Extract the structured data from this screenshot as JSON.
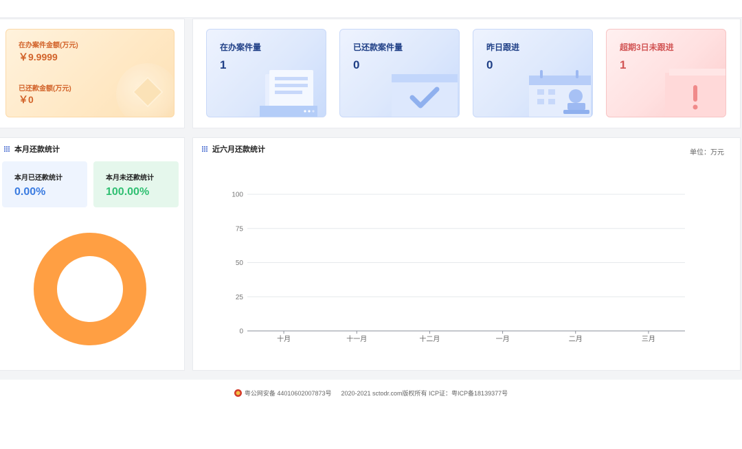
{
  "money": {
    "active_label": "在办案件金额(万元)",
    "active_value": "￥9.9999",
    "repaid_label": "已还款金额(万元)",
    "repaid_value": "￥0"
  },
  "stats": [
    {
      "title": "在办案件量",
      "value": "1"
    },
    {
      "title": "已还款案件量",
      "value": "0"
    },
    {
      "title": "昨日跟进",
      "value": "0"
    },
    {
      "title": "超期3日未跟进",
      "value": "1"
    }
  ],
  "monthly": {
    "title": "本月还款统计",
    "repaid_label": "本月已还款统计",
    "repaid_value": "0.00%",
    "unpaid_label": "本月未还款统计",
    "unpaid_value": "100.00%"
  },
  "colors": {
    "repaid": "#3a7be0",
    "unpaid": "#2fbf71",
    "donut": "#ff9f43"
  },
  "trend": {
    "title": "近六月还款统计",
    "unit": "单位：万元"
  },
  "chart_data": [
    {
      "type": "pie",
      "title": "",
      "labels": [
        "本月已还款统计",
        "本月未还款统计"
      ],
      "values": [
        0,
        100
      ]
    },
    {
      "type": "line",
      "title": "",
      "categories": [
        "十月",
        "十一月",
        "十二月",
        "一月",
        "二月",
        "三月"
      ],
      "series": [
        {
          "values": [
            0,
            0,
            0,
            0,
            0,
            0
          ]
        }
      ],
      "ylim": [
        0,
        100
      ],
      "yticks": [
        "0",
        "25",
        "50",
        "75",
        "100"
      ],
      "grid": true
    }
  ],
  "footer": {
    "police": "粤公网安备 44010602007873号",
    "copyright": "2020-2021 sctodr.com版权所有 ICP证：粤ICP备18139377号"
  }
}
